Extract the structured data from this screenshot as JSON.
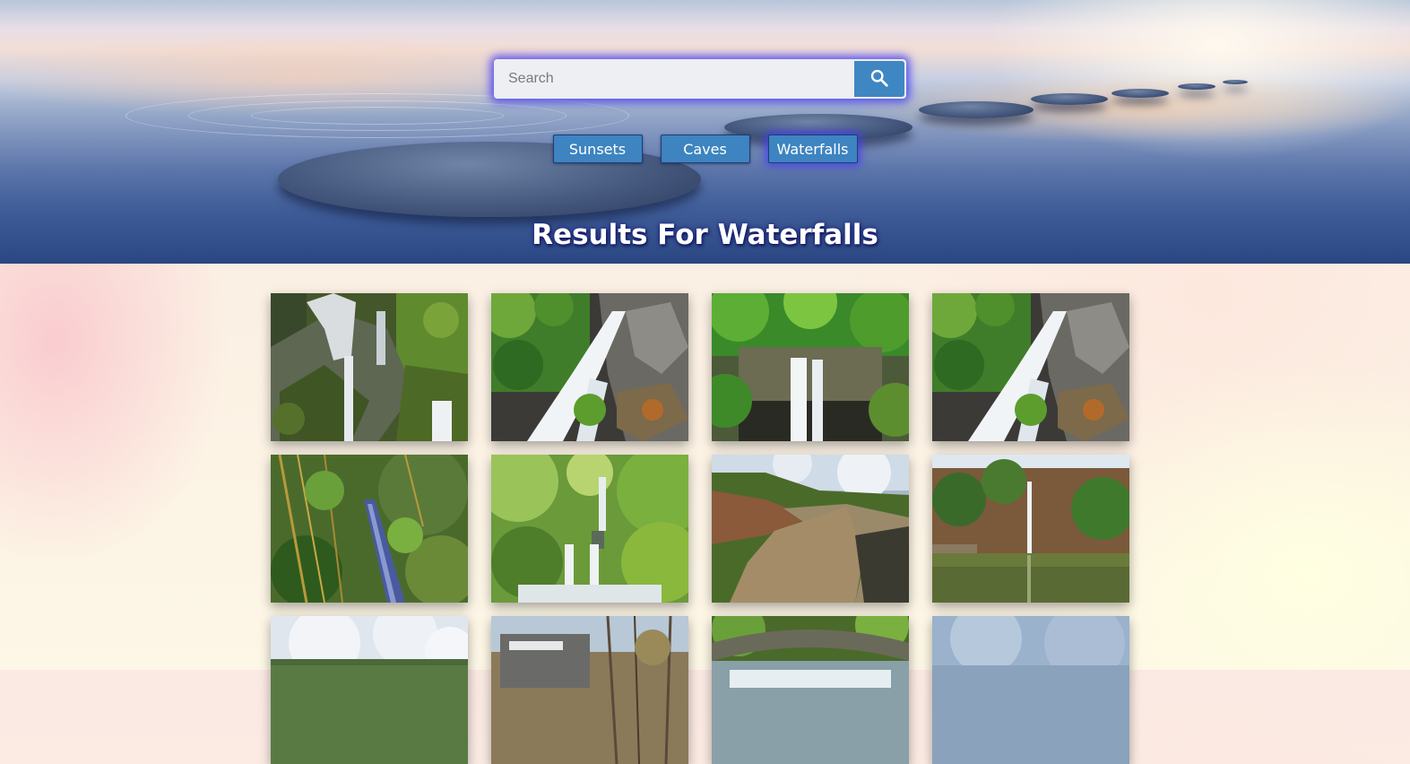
{
  "search": {
    "placeholder": "Search"
  },
  "categories": [
    {
      "label": "Sunsets",
      "active": false
    },
    {
      "label": "Caves",
      "active": false
    },
    {
      "label": "Waterfalls",
      "active": true
    }
  ],
  "results_title": "Results For Waterfalls",
  "colors": {
    "button_blue": "#3d84c0",
    "glow": "#463cf0",
    "title_text": "#ffffff"
  },
  "icons": {
    "search_button": "search-icon"
  },
  "gallery": {
    "photos": [
      {
        "subject": "mossy-rock-cascade"
      },
      {
        "subject": "waterfall-over-dark-rocks"
      },
      {
        "subject": "twin-falls-in-gorge"
      },
      {
        "subject": "waterfall-over-dark-rocks"
      },
      {
        "subject": "stream-behind-bamboo"
      },
      {
        "subject": "tiered-jungle-falls"
      },
      {
        "subject": "muddy-river-canyon"
      },
      {
        "subject": "cliff-falls-into-lake"
      },
      {
        "subject": "cloudy-landscape"
      },
      {
        "subject": "old-shed-in-woods"
      },
      {
        "subject": "stone-bridge-over-rapids"
      },
      {
        "subject": "overcast-sky"
      }
    ]
  }
}
